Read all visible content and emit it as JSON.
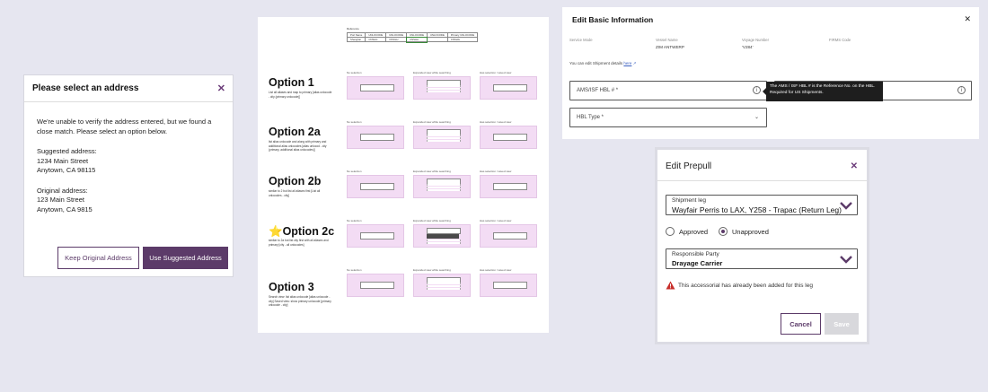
{
  "address_modal": {
    "title": "Please select an address",
    "message": "We're unable to verify the address entered, but we found a close match.  Please select an option below.",
    "suggested_label": "Suggested address:",
    "suggested_line1": "1234 Main Street",
    "suggested_line2": "Anytown, CA 98115",
    "original_label": "Original address:",
    "original_line1": "123 Main Street",
    "original_line2": "Anytown, CA 9815",
    "keep_button": "Keep Original Address",
    "use_button": "Use Suggested Address",
    "close_icon": "close-icon"
  },
  "spec": {
    "reference_caption": "Reference",
    "reference_headers": [
      "Port Name",
      "UNLOCODE",
      "UNLOCODE",
      "UNLOCODE",
      "UNLOCODE",
      "Primary UNLOCODE"
    ],
    "reference_row": [
      "Shanghai",
      "CNSHG",
      "CNSGH",
      "CNSHA",
      "",
      "CNSHG"
    ],
    "col_captions": [
      "No selection",
      "Expanded view while searching",
      "Has selection / saved view"
    ],
    "options": [
      {
        "name": "Option 1",
        "desc": "List all aliases and map to primary [alias unlocode - city (primary unlocode)]"
      },
      {
        "name": "Option 2a",
        "desc": "list alias unlocode and along with primary and additional alias unlocodes [alias unlocod - city (primary, additional alias unlocodes)]"
      },
      {
        "name": "Option 2b",
        "desc": "similar to 2 but list all aliases first [List all unlocodes - city]"
      },
      {
        "name": "⭐Option 2c",
        "desc": "similar to 2a but list city first with all aliases and primary [city - all unlocodes]"
      },
      {
        "name": "Option 3",
        "desc": "Search view: list alias unlocode [alias unlocode - city] Saved view: show primary unlocode [primary unlocode - city]"
      }
    ]
  },
  "edit_basic": {
    "title": "Edit Basic Information",
    "fields": [
      {
        "label": "Service Mode",
        "value": ""
      },
      {
        "label": "Vessel Name",
        "value": "ZIM ANTWERP"
      },
      {
        "label": "Voyage Number",
        "value": "'V284'"
      },
      {
        "label": "FIRMS Code",
        "value": ""
      }
    ],
    "note": "You can edit Shipment details",
    "note_link": "here",
    "ams_label": "AMS/ISF HBL # *",
    "hbl_type_label": "HBL Type *",
    "tooltip": "The AMS / ISF HBL # is the Reference No. on the HBL. Required for US Shipments."
  },
  "prepull": {
    "title": "Edit Prepull",
    "shipment_leg_label": "Shipment leg",
    "shipment_leg_value": "Wayfair Perris to LAX, Y258 - Trapac (Return Leg)",
    "approved": "Approved",
    "unapproved": "Unapproved",
    "selected": "Unapproved",
    "responsible_label": "Responsible Party",
    "responsible_value": "Drayage Carrier",
    "warning": "This accessorial has already been added for this leg",
    "cancel": "Cancel",
    "save": "Save",
    "accent": "#5c3b69",
    "warning_color": "#c8302c"
  }
}
